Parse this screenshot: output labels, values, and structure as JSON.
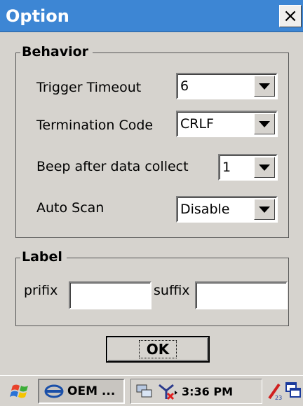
{
  "window": {
    "title": "Option",
    "close_symbol": "×"
  },
  "behavior": {
    "title": "Behavior",
    "rows": [
      {
        "label": "Trigger Timeout",
        "value": "6"
      },
      {
        "label": "Termination Code",
        "value": "CRLF"
      },
      {
        "label": "Beep after data collect",
        "value": "1"
      },
      {
        "label": "Auto Scan",
        "value": "Disable"
      }
    ]
  },
  "label_group": {
    "title": "Label",
    "prefix_label": "prifix",
    "prefix_value": "",
    "suffix_label": "suffix",
    "suffix_value": ""
  },
  "ok_label": "OK",
  "taskbar": {
    "task_label": "OEM ...",
    "clock": "3:36 PM",
    "icons": [
      "windows-start-icon",
      "oem-app-icon",
      "network-icon",
      "connectivity-off-icon",
      "input-panel-icon",
      "desktop-icon"
    ]
  },
  "colors": {
    "title_bar": "#3d86d4",
    "background": "#d6d3ce"
  }
}
